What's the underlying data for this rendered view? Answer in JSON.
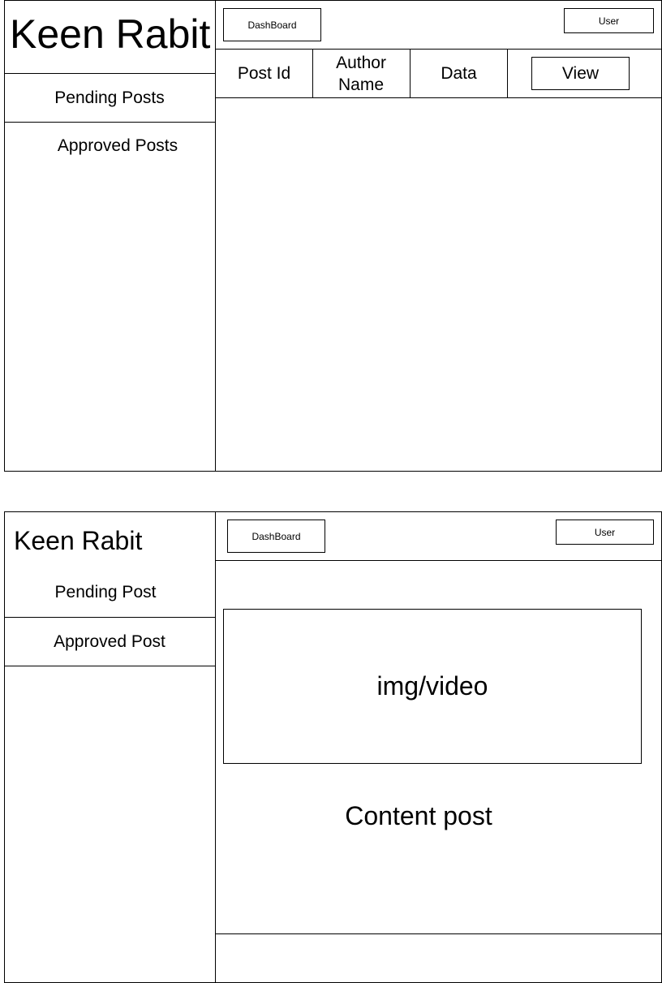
{
  "list_view": {
    "brand": "Keen Rabit",
    "nav": {
      "pending": "Pending Posts",
      "approved": "Approved Posts"
    },
    "header": {
      "dashboard_button": "DashBoard",
      "user_button": "User"
    },
    "table": {
      "columns": [
        "Post Id",
        "Author Name",
        "Data"
      ],
      "view_button": "View"
    }
  },
  "detail_view": {
    "brand": "Keen Rabit",
    "nav": {
      "pending": "Pending Post",
      "approved": "Approved Post"
    },
    "header": {
      "dashboard_button": "DashBoard",
      "user_button": "User"
    },
    "media_placeholder": "img/video",
    "content_text": "Content post"
  }
}
